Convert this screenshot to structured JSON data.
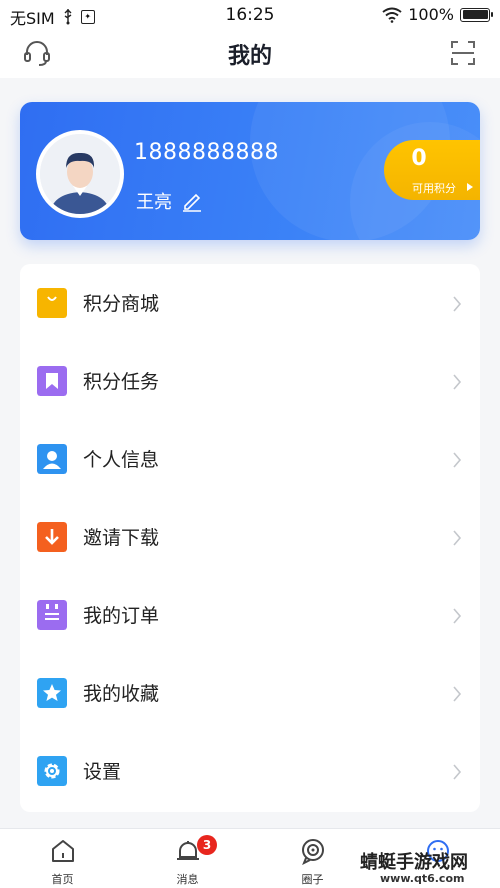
{
  "status_bar": {
    "carrier": "无SIM",
    "time": "16:25",
    "battery": "100%"
  },
  "header": {
    "title": "我的",
    "left_icon": "headset-icon",
    "right_icon": "scan-icon"
  },
  "profile": {
    "phone": "1888888888",
    "name": "王亮",
    "points_value": "0",
    "points_label": "可用积分"
  },
  "menu": [
    {
      "label": "积分商城",
      "icon": "shop-bag-icon",
      "color": "#f7b500"
    },
    {
      "label": "积分任务",
      "icon": "bookmark-icon",
      "color": "#9b6cf0"
    },
    {
      "label": "个人信息",
      "icon": "person-icon",
      "color": "#2e93f0"
    },
    {
      "label": "邀请下载",
      "icon": "download-icon",
      "color": "#f4601f"
    },
    {
      "label": "我的订单",
      "icon": "order-list-icon",
      "color": "#9b6cf0"
    },
    {
      "label": "我的收藏",
      "icon": "star-icon",
      "color": "#2fa3f2"
    },
    {
      "label": "设置",
      "icon": "gear-icon",
      "color": "#2fa3f2"
    }
  ],
  "tabbar": {
    "tabs": [
      {
        "label": "首页",
        "icon": "home-icon"
      },
      {
        "label": "消息",
        "icon": "bell-icon",
        "badge": "3"
      },
      {
        "label": "圈子",
        "icon": "circle-icon"
      },
      {
        "label": "",
        "icon": "profile-icon"
      }
    ]
  },
  "watermark": {
    "title": "蜻蜓手游戏网",
    "url": "www.qt6.com"
  },
  "colors": {
    "accent": "#2f6ef2",
    "points": "#f4b400",
    "badge": "#e8261e"
  }
}
